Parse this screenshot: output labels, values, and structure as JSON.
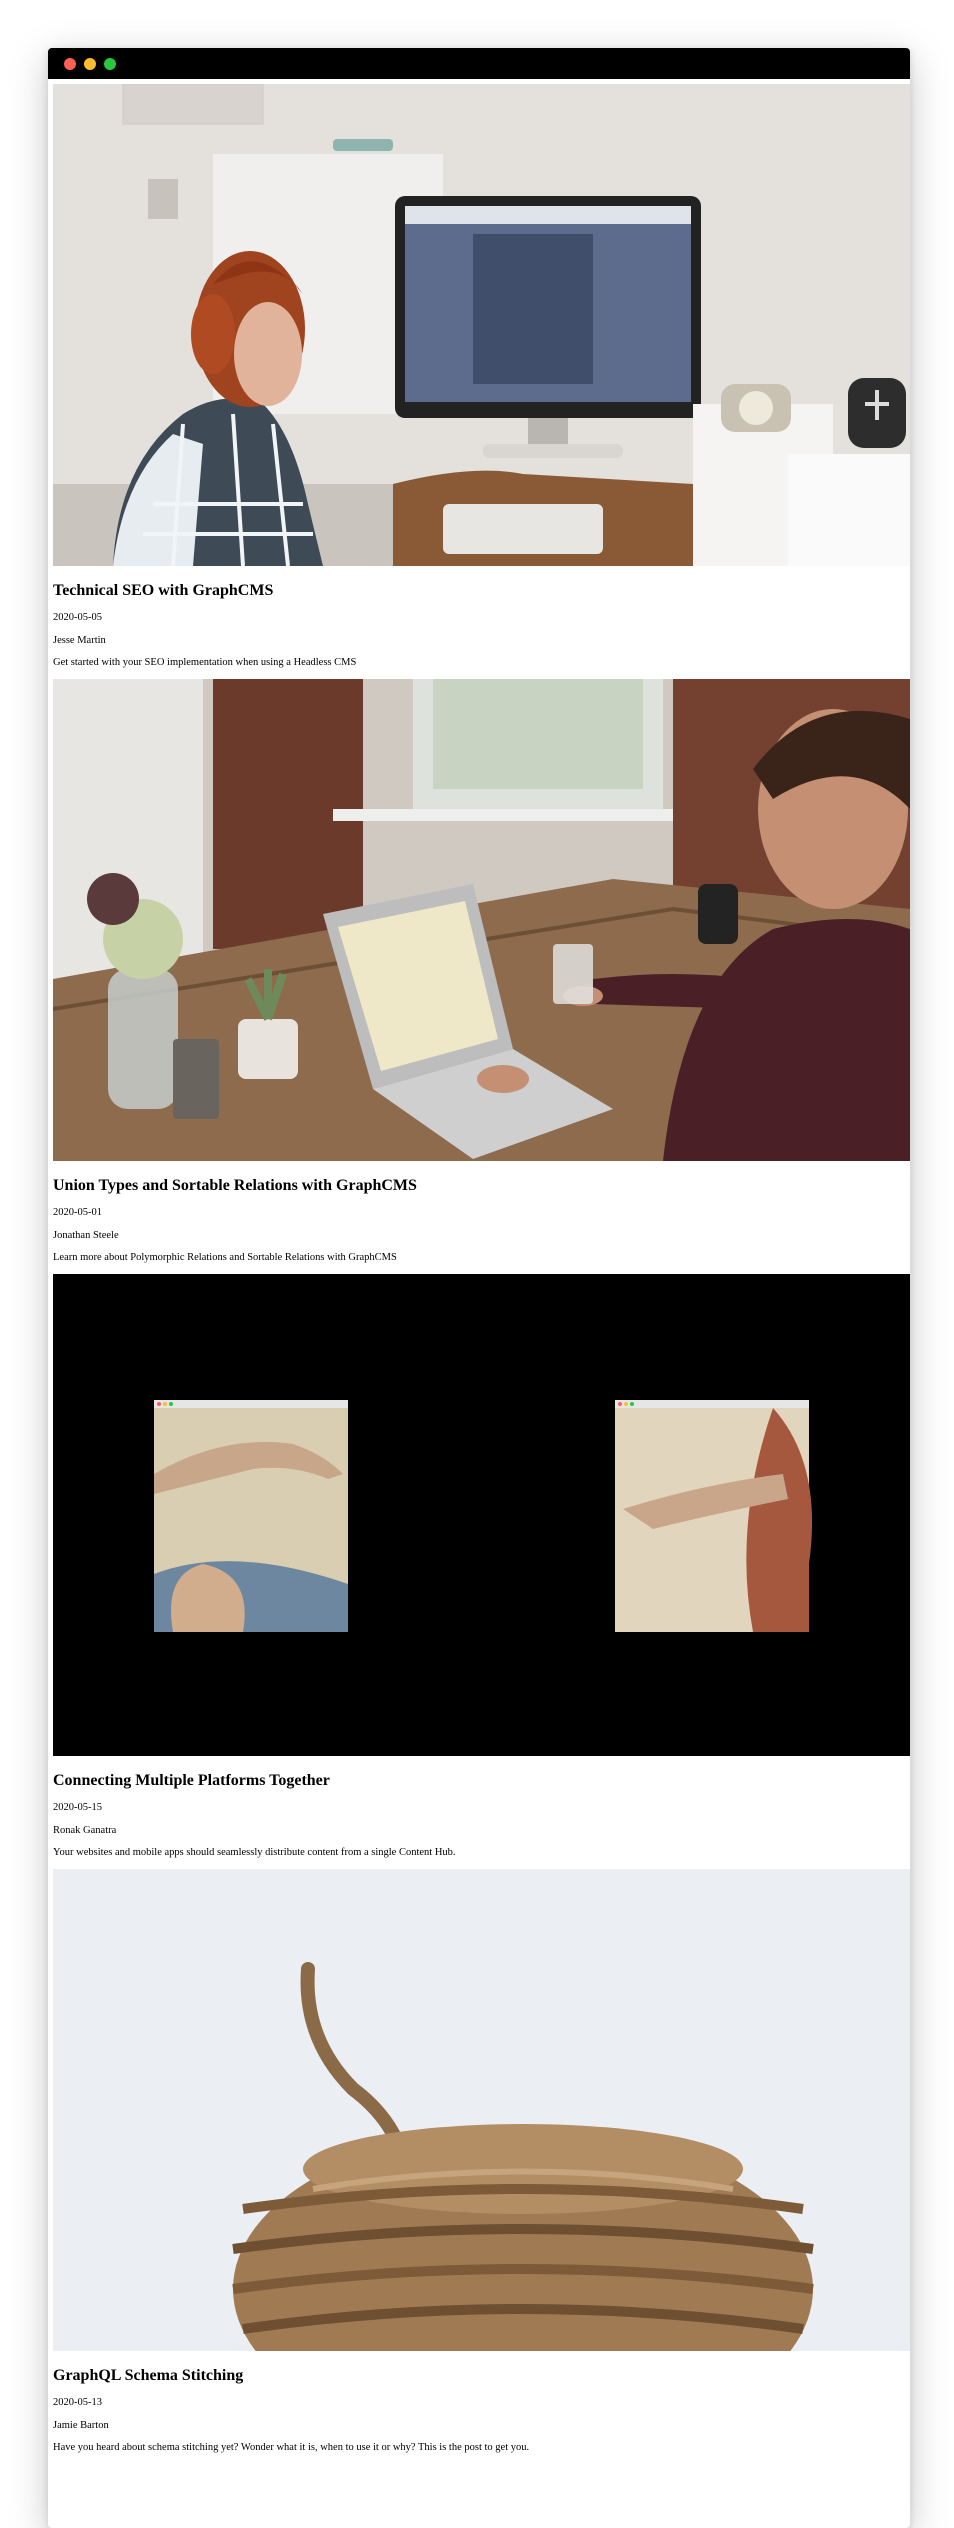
{
  "window": {
    "controls": [
      "close",
      "minimize",
      "maximize"
    ]
  },
  "colors": {
    "close": "#ff5f57",
    "minimize": "#febc2e",
    "maximize": "#28c840",
    "titlebar": "#000000"
  },
  "posts": [
    {
      "image": "woman-at-desktop-computer",
      "title": "Technical SEO with GraphCMS",
      "date": "2020-05-05",
      "author": "Jesse Martin",
      "excerpt": "Get started with your SEO implementation when using a Headless CMS"
    },
    {
      "image": "man-typing-on-laptop",
      "title": "Union Types and Sortable Relations with GraphCMS",
      "date": "2020-05-01",
      "author": "Jonathan Steele",
      "excerpt": "Learn more about Polymorphic Relations and Sortable Relations with GraphCMS"
    },
    {
      "image": "creation-of-adam-hands",
      "title": "Connecting Multiple Platforms Together",
      "date": "2020-05-15",
      "author": "Ronak Ganatra",
      "excerpt": "Your websites and mobile apps should seamlessly distribute content from a single Content Hub."
    },
    {
      "image": "twine-rope-ball",
      "title": "GraphQL Schema Stitching",
      "date": "2020-05-13",
      "author": "Jamie Barton",
      "excerpt": "Have you heard about schema stitching yet? Wonder what it is, when to use it or why? This is the post to get you."
    }
  ]
}
